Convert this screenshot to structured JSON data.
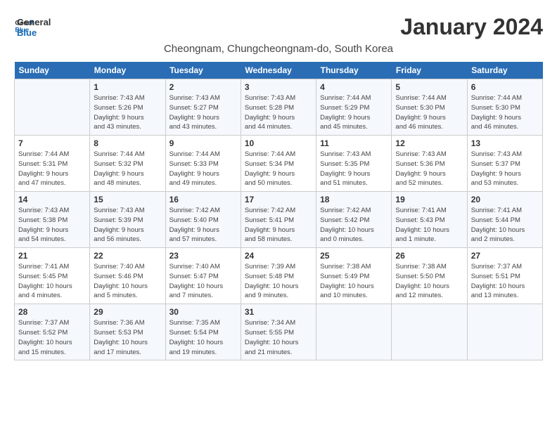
{
  "logo": {
    "line1": "General",
    "line2": "Blue"
  },
  "title": "January 2024",
  "subtitle": "Cheongnam, Chungcheongnam-do, South Korea",
  "days_of_week": [
    "Sunday",
    "Monday",
    "Tuesday",
    "Wednesday",
    "Thursday",
    "Friday",
    "Saturday"
  ],
  "weeks": [
    [
      {
        "day": "",
        "info": ""
      },
      {
        "day": "1",
        "info": "Sunrise: 7:43 AM\nSunset: 5:26 PM\nDaylight: 9 hours\nand 43 minutes."
      },
      {
        "day": "2",
        "info": "Sunrise: 7:43 AM\nSunset: 5:27 PM\nDaylight: 9 hours\nand 43 minutes."
      },
      {
        "day": "3",
        "info": "Sunrise: 7:43 AM\nSunset: 5:28 PM\nDaylight: 9 hours\nand 44 minutes."
      },
      {
        "day": "4",
        "info": "Sunrise: 7:44 AM\nSunset: 5:29 PM\nDaylight: 9 hours\nand 45 minutes."
      },
      {
        "day": "5",
        "info": "Sunrise: 7:44 AM\nSunset: 5:30 PM\nDaylight: 9 hours\nand 46 minutes."
      },
      {
        "day": "6",
        "info": "Sunrise: 7:44 AM\nSunset: 5:30 PM\nDaylight: 9 hours\nand 46 minutes."
      }
    ],
    [
      {
        "day": "7",
        "info": "Sunrise: 7:44 AM\nSunset: 5:31 PM\nDaylight: 9 hours\nand 47 minutes."
      },
      {
        "day": "8",
        "info": "Sunrise: 7:44 AM\nSunset: 5:32 PM\nDaylight: 9 hours\nand 48 minutes."
      },
      {
        "day": "9",
        "info": "Sunrise: 7:44 AM\nSunset: 5:33 PM\nDaylight: 9 hours\nand 49 minutes."
      },
      {
        "day": "10",
        "info": "Sunrise: 7:44 AM\nSunset: 5:34 PM\nDaylight: 9 hours\nand 50 minutes."
      },
      {
        "day": "11",
        "info": "Sunrise: 7:43 AM\nSunset: 5:35 PM\nDaylight: 9 hours\nand 51 minutes."
      },
      {
        "day": "12",
        "info": "Sunrise: 7:43 AM\nSunset: 5:36 PM\nDaylight: 9 hours\nand 52 minutes."
      },
      {
        "day": "13",
        "info": "Sunrise: 7:43 AM\nSunset: 5:37 PM\nDaylight: 9 hours\nand 53 minutes."
      }
    ],
    [
      {
        "day": "14",
        "info": "Sunrise: 7:43 AM\nSunset: 5:38 PM\nDaylight: 9 hours\nand 54 minutes."
      },
      {
        "day": "15",
        "info": "Sunrise: 7:43 AM\nSunset: 5:39 PM\nDaylight: 9 hours\nand 56 minutes."
      },
      {
        "day": "16",
        "info": "Sunrise: 7:42 AM\nSunset: 5:40 PM\nDaylight: 9 hours\nand 57 minutes."
      },
      {
        "day": "17",
        "info": "Sunrise: 7:42 AM\nSunset: 5:41 PM\nDaylight: 9 hours\nand 58 minutes."
      },
      {
        "day": "18",
        "info": "Sunrise: 7:42 AM\nSunset: 5:42 PM\nDaylight: 10 hours\nand 0 minutes."
      },
      {
        "day": "19",
        "info": "Sunrise: 7:41 AM\nSunset: 5:43 PM\nDaylight: 10 hours\nand 1 minute."
      },
      {
        "day": "20",
        "info": "Sunrise: 7:41 AM\nSunset: 5:44 PM\nDaylight: 10 hours\nand 2 minutes."
      }
    ],
    [
      {
        "day": "21",
        "info": "Sunrise: 7:41 AM\nSunset: 5:45 PM\nDaylight: 10 hours\nand 4 minutes."
      },
      {
        "day": "22",
        "info": "Sunrise: 7:40 AM\nSunset: 5:46 PM\nDaylight: 10 hours\nand 5 minutes."
      },
      {
        "day": "23",
        "info": "Sunrise: 7:40 AM\nSunset: 5:47 PM\nDaylight: 10 hours\nand 7 minutes."
      },
      {
        "day": "24",
        "info": "Sunrise: 7:39 AM\nSunset: 5:48 PM\nDaylight: 10 hours\nand 9 minutes."
      },
      {
        "day": "25",
        "info": "Sunrise: 7:38 AM\nSunset: 5:49 PM\nDaylight: 10 hours\nand 10 minutes."
      },
      {
        "day": "26",
        "info": "Sunrise: 7:38 AM\nSunset: 5:50 PM\nDaylight: 10 hours\nand 12 minutes."
      },
      {
        "day": "27",
        "info": "Sunrise: 7:37 AM\nSunset: 5:51 PM\nDaylight: 10 hours\nand 13 minutes."
      }
    ],
    [
      {
        "day": "28",
        "info": "Sunrise: 7:37 AM\nSunset: 5:52 PM\nDaylight: 10 hours\nand 15 minutes."
      },
      {
        "day": "29",
        "info": "Sunrise: 7:36 AM\nSunset: 5:53 PM\nDaylight: 10 hours\nand 17 minutes."
      },
      {
        "day": "30",
        "info": "Sunrise: 7:35 AM\nSunset: 5:54 PM\nDaylight: 10 hours\nand 19 minutes."
      },
      {
        "day": "31",
        "info": "Sunrise: 7:34 AM\nSunset: 5:55 PM\nDaylight: 10 hours\nand 21 minutes."
      },
      {
        "day": "",
        "info": ""
      },
      {
        "day": "",
        "info": ""
      },
      {
        "day": "",
        "info": ""
      }
    ]
  ]
}
